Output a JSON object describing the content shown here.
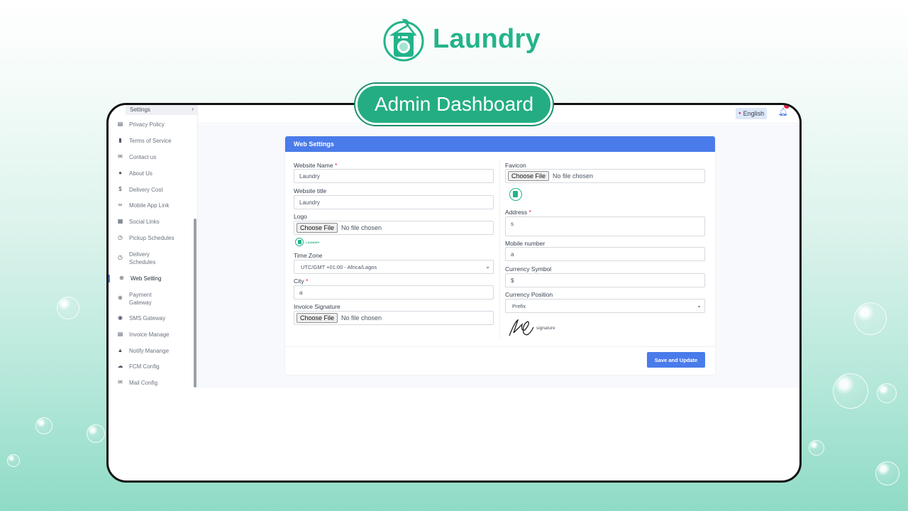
{
  "brand": {
    "name": "Laundry",
    "color": "#23b38a"
  },
  "hero": {
    "pill": "Admin Dashboard"
  },
  "topbar": {
    "language": "English"
  },
  "sidebar": {
    "section": "Settings",
    "items": [
      {
        "label": "Privacy Policy",
        "icon": "printer-icon"
      },
      {
        "label": "Terms of Service",
        "icon": "file-icon"
      },
      {
        "label": "Contact us",
        "icon": "envelope-icon"
      },
      {
        "label": "About Us",
        "icon": "info-icon"
      },
      {
        "label": "Delivery Cost",
        "icon": "dollar-icon"
      },
      {
        "label": "Mobile App Link",
        "icon": "link-icon"
      },
      {
        "label": "Social Links",
        "icon": "qr-icon"
      },
      {
        "label": "Pickup Schedules",
        "icon": "clock-icon"
      },
      {
        "label": "Delivery Schedules",
        "icon": "clock-icon"
      },
      {
        "label": "Web Setting",
        "icon": "globe-icon"
      },
      {
        "label": "Payment Gateway",
        "icon": "globe-icon"
      },
      {
        "label": "SMS Gateway",
        "icon": "chat-icon"
      },
      {
        "label": "Invoice Manage",
        "icon": "printer-icon"
      },
      {
        "label": "Notify Manange",
        "icon": "bell-icon"
      },
      {
        "label": "FCM Config",
        "icon": "cloud-icon"
      },
      {
        "label": "Mail Config",
        "icon": "envelope-icon"
      }
    ]
  },
  "form": {
    "title": "Web Settings",
    "website_name": {
      "label": "Website Name",
      "value": "Laundry"
    },
    "website_title": {
      "label": "Website title",
      "value": "Laundry"
    },
    "logo": {
      "label": "Logo",
      "button": "Choose File",
      "status": "No file chosen",
      "preview_text": "LAUNDRY"
    },
    "time_zone": {
      "label": "Time Zone",
      "value": "UTC/GMT +01:00 - Africa/Lagos"
    },
    "city": {
      "label": "City",
      "value": "a"
    },
    "invoice_signature": {
      "label": "Invoice Signature",
      "button": "Choose File",
      "status": "No file chosen"
    },
    "favicon": {
      "label": "Favicon",
      "button": "Choose File",
      "status": "No file chosen"
    },
    "address": {
      "label": "Address",
      "value": "s"
    },
    "mobile": {
      "label": "Mobile number",
      "value": "a"
    },
    "currency_symbol": {
      "label": "Currency Symbol",
      "value": "$"
    },
    "currency_position": {
      "label": "Currency Position",
      "value": "Prefix"
    },
    "signature_caption": "signature",
    "required_mark": "*",
    "save_label": "Save and Update"
  },
  "colors": {
    "primary": "#4a7bea",
    "pill": "#24ad83"
  }
}
